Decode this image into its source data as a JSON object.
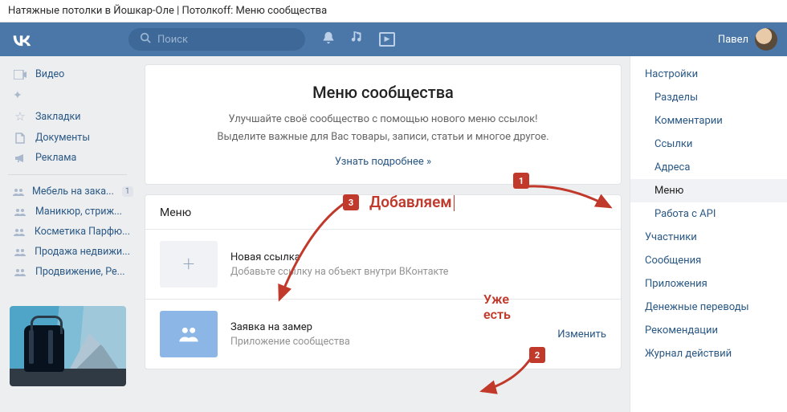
{
  "browser": {
    "title": "Натяжные потолки в Йошкар-Оле | Потолкоff: Меню сообщества"
  },
  "header": {
    "search_placeholder": "Поиск",
    "user_name": "Павел"
  },
  "left_nav": {
    "items_top": [
      {
        "icon": "video-icon",
        "glyph": "▮▮",
        "label": "Видео"
      }
    ],
    "items_mid": [
      {
        "icon": "star-icon",
        "glyph": "☆",
        "label": "Закладки"
      },
      {
        "icon": "document-icon",
        "glyph": "🗎",
        "label": "Документы"
      },
      {
        "icon": "ads-icon",
        "glyph": "📢",
        "label": "Реклама"
      }
    ],
    "groups": [
      {
        "label": "Мебель на зака...",
        "badge": "1"
      },
      {
        "label": "Маникюр, стриж..."
      },
      {
        "label": "Косметика Парфю..."
      },
      {
        "label": "Продажа недвижи..."
      },
      {
        "label": "Продвижение, Ре..."
      }
    ]
  },
  "banner": {
    "title": "Меню сообщества",
    "line1": "Улучшайте своё сообщество с помощью нового меню ссылок!",
    "line2": "Выделите важные для Вас товары, записи, статьи и многое другое.",
    "learn_more": "Узнать подробнее »"
  },
  "menu_section": {
    "header": "Меню",
    "new_link": {
      "title": "Новая ссылка",
      "subtitle": "Добавьте ссылку на объект внутри ВКонтакте"
    },
    "existing": {
      "title": "Заявка на замер",
      "subtitle": "Приложение сообщества",
      "action": "Изменить"
    }
  },
  "right_nav": {
    "items": [
      {
        "label": "Настройки",
        "sub": false
      },
      {
        "label": "Разделы",
        "sub": true
      },
      {
        "label": "Комментарии",
        "sub": true
      },
      {
        "label": "Ссылки",
        "sub": true
      },
      {
        "label": "Адреса",
        "sub": true
      },
      {
        "label": "Меню",
        "sub": true,
        "active": true
      },
      {
        "label": "Работа с API",
        "sub": true
      },
      {
        "label": "Участники",
        "sub": false
      },
      {
        "label": "Сообщения",
        "sub": false
      },
      {
        "label": "Приложения",
        "sub": false
      },
      {
        "label": "Денежные переводы",
        "sub": false
      },
      {
        "label": "Рекомендации",
        "sub": false
      },
      {
        "label": "Журнал действий",
        "sub": false
      }
    ]
  },
  "annotations": {
    "b1": "1",
    "b2": "2",
    "b3": "3",
    "add_text": "Добавляем",
    "already1": "Уже",
    "already2": "есть"
  }
}
